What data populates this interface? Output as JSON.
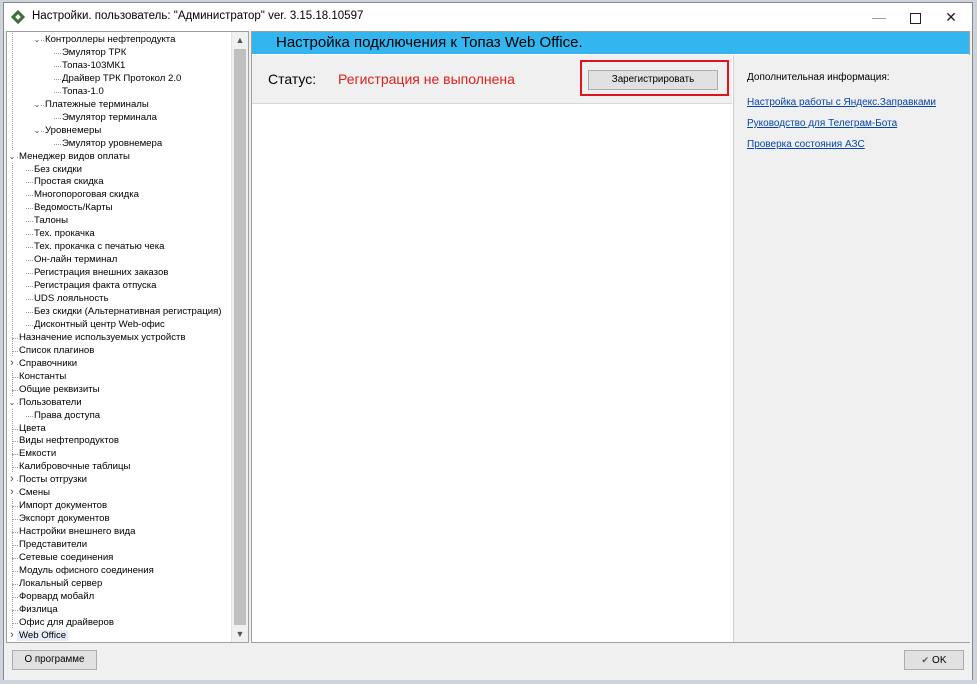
{
  "window": {
    "title": "Настройки. пользователь: \"Администратор\" ver. 3.15.18.10597",
    "controls": {
      "minimize": "—",
      "close": "✕"
    }
  },
  "tree": {
    "items": [
      {
        "label": "Контроллеры нефтепродукта",
        "level": 2,
        "arrow": "expanded"
      },
      {
        "label": "Эмулятор ТРК",
        "level": 3
      },
      {
        "label": "Топаз-103МК1",
        "level": 3
      },
      {
        "label": "Драйвер ТРК Протокол 2.0",
        "level": 3
      },
      {
        "label": "Топаз-1.0",
        "level": 3
      },
      {
        "label": "Платежные терминалы",
        "level": 2,
        "arrow": "expanded"
      },
      {
        "label": "Эмулятор терминала",
        "level": 3
      },
      {
        "label": "Уровнемеры",
        "level": 2,
        "arrow": "expanded"
      },
      {
        "label": "Эмулятор уровнемера",
        "level": 3
      },
      {
        "label": "Менеджер видов оплаты",
        "level": 0,
        "arrow": "expanded"
      },
      {
        "label": "Без скидки",
        "level": 1
      },
      {
        "label": "Простая скидка",
        "level": 1
      },
      {
        "label": "Многопороговая скидка",
        "level": 1
      },
      {
        "label": "Ведомость/Карты",
        "level": 1
      },
      {
        "label": "Талоны",
        "level": 1
      },
      {
        "label": "Тех. прокачка",
        "level": 1
      },
      {
        "label": "Тех. прокачка с печатью чека",
        "level": 1
      },
      {
        "label": "Он-лайн терминал",
        "level": 1
      },
      {
        "label": "Регистрация внешних заказов",
        "level": 1
      },
      {
        "label": "Регистрация факта отпуска",
        "level": 1
      },
      {
        "label": "UDS лояльность",
        "level": 1
      },
      {
        "label": "Без скидки (Альтернативная регистрация)",
        "level": 1
      },
      {
        "label": "Дисконтный центр Web-офис",
        "level": 1
      },
      {
        "label": "Назначение используемых устройств",
        "level": 0
      },
      {
        "label": "Список плагинов",
        "level": 0
      },
      {
        "label": "Справочники",
        "level": 0,
        "arrow": "collapsed"
      },
      {
        "label": "Константы",
        "level": 0
      },
      {
        "label": "Общие реквизиты",
        "level": 0
      },
      {
        "label": "Пользователи",
        "level": 0,
        "arrow": "expanded"
      },
      {
        "label": "Права доступа",
        "level": 1
      },
      {
        "label": "Цвета",
        "level": 0
      },
      {
        "label": "Виды нефтепродуктов",
        "level": 0
      },
      {
        "label": "Емкости",
        "level": 0
      },
      {
        "label": "Калибровочные таблицы",
        "level": 0
      },
      {
        "label": "Посты отгрузки",
        "level": 0,
        "arrow": "collapsed"
      },
      {
        "label": "Смены",
        "level": 0,
        "arrow": "collapsed"
      },
      {
        "label": "Импорт документов",
        "level": 0
      },
      {
        "label": "Экспорт документов",
        "level": 0
      },
      {
        "label": "Настройки внешнего вида",
        "level": 0
      },
      {
        "label": "Представители",
        "level": 0
      },
      {
        "label": "Сетевые соединения",
        "level": 0
      },
      {
        "label": "Модуль офисного соединения",
        "level": 0
      },
      {
        "label": "Локальный сервер",
        "level": 0
      },
      {
        "label": "Форвард мобайл",
        "level": 0
      },
      {
        "label": "Физлица",
        "level": 0
      },
      {
        "label": "Офис для драйверов",
        "level": 0
      },
      {
        "label": "Web Office",
        "level": 0,
        "arrow": "collapsed",
        "selected": true
      }
    ]
  },
  "main": {
    "header_title": "Настройка подключения к Топаз Web Office.",
    "status_label": "Статус:",
    "status_value": "Регистрация не выполнена",
    "register_button": "Зарегистрировать",
    "info": {
      "title": "Дополнительная информация:",
      "links": [
        "Настройка работы с Яндекс.Заправками",
        "Руководство для Телеграм-Бота",
        "Проверка состояния АЗС"
      ]
    }
  },
  "footer": {
    "about_button": "О программе",
    "ok_button": "OK"
  },
  "colors": {
    "header_bar": "#33b6f0",
    "status_error": "#e01e1e",
    "highlight_frame": "#e0141e",
    "link": "#0645ad"
  }
}
